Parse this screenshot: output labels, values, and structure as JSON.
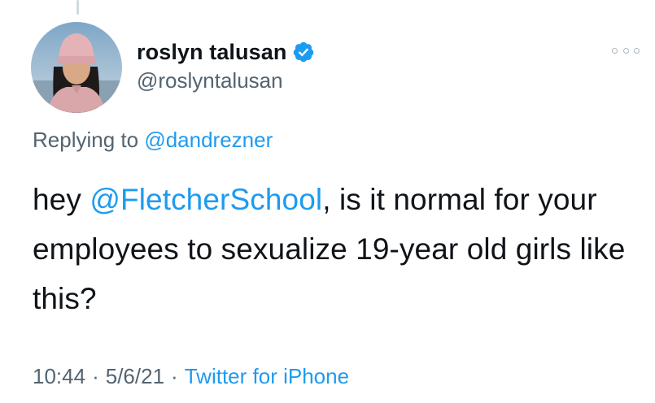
{
  "tweet": {
    "author": {
      "display_name": "roslyn talusan",
      "handle": "@roslyntalusan",
      "verified_icon": "verified-badge-icon",
      "avatar": "profile-photo"
    },
    "more_icon": "more-dots-icon",
    "reply": {
      "prefix": "Replying to",
      "mention": "@dandrezner"
    },
    "text": {
      "part1": "hey ",
      "mention": "@FletcherSchool",
      "part2": ", is it normal for your employees to sexualize 19-year old girls like this?"
    },
    "meta": {
      "time": "10:44",
      "separator": "·",
      "date": "5/6/21",
      "source": "Twitter for iPhone"
    }
  },
  "colors": {
    "link": "#1d9bf0",
    "secondary_text": "#536471",
    "primary_text": "#0f1419",
    "verified": "#1d9bf0"
  }
}
